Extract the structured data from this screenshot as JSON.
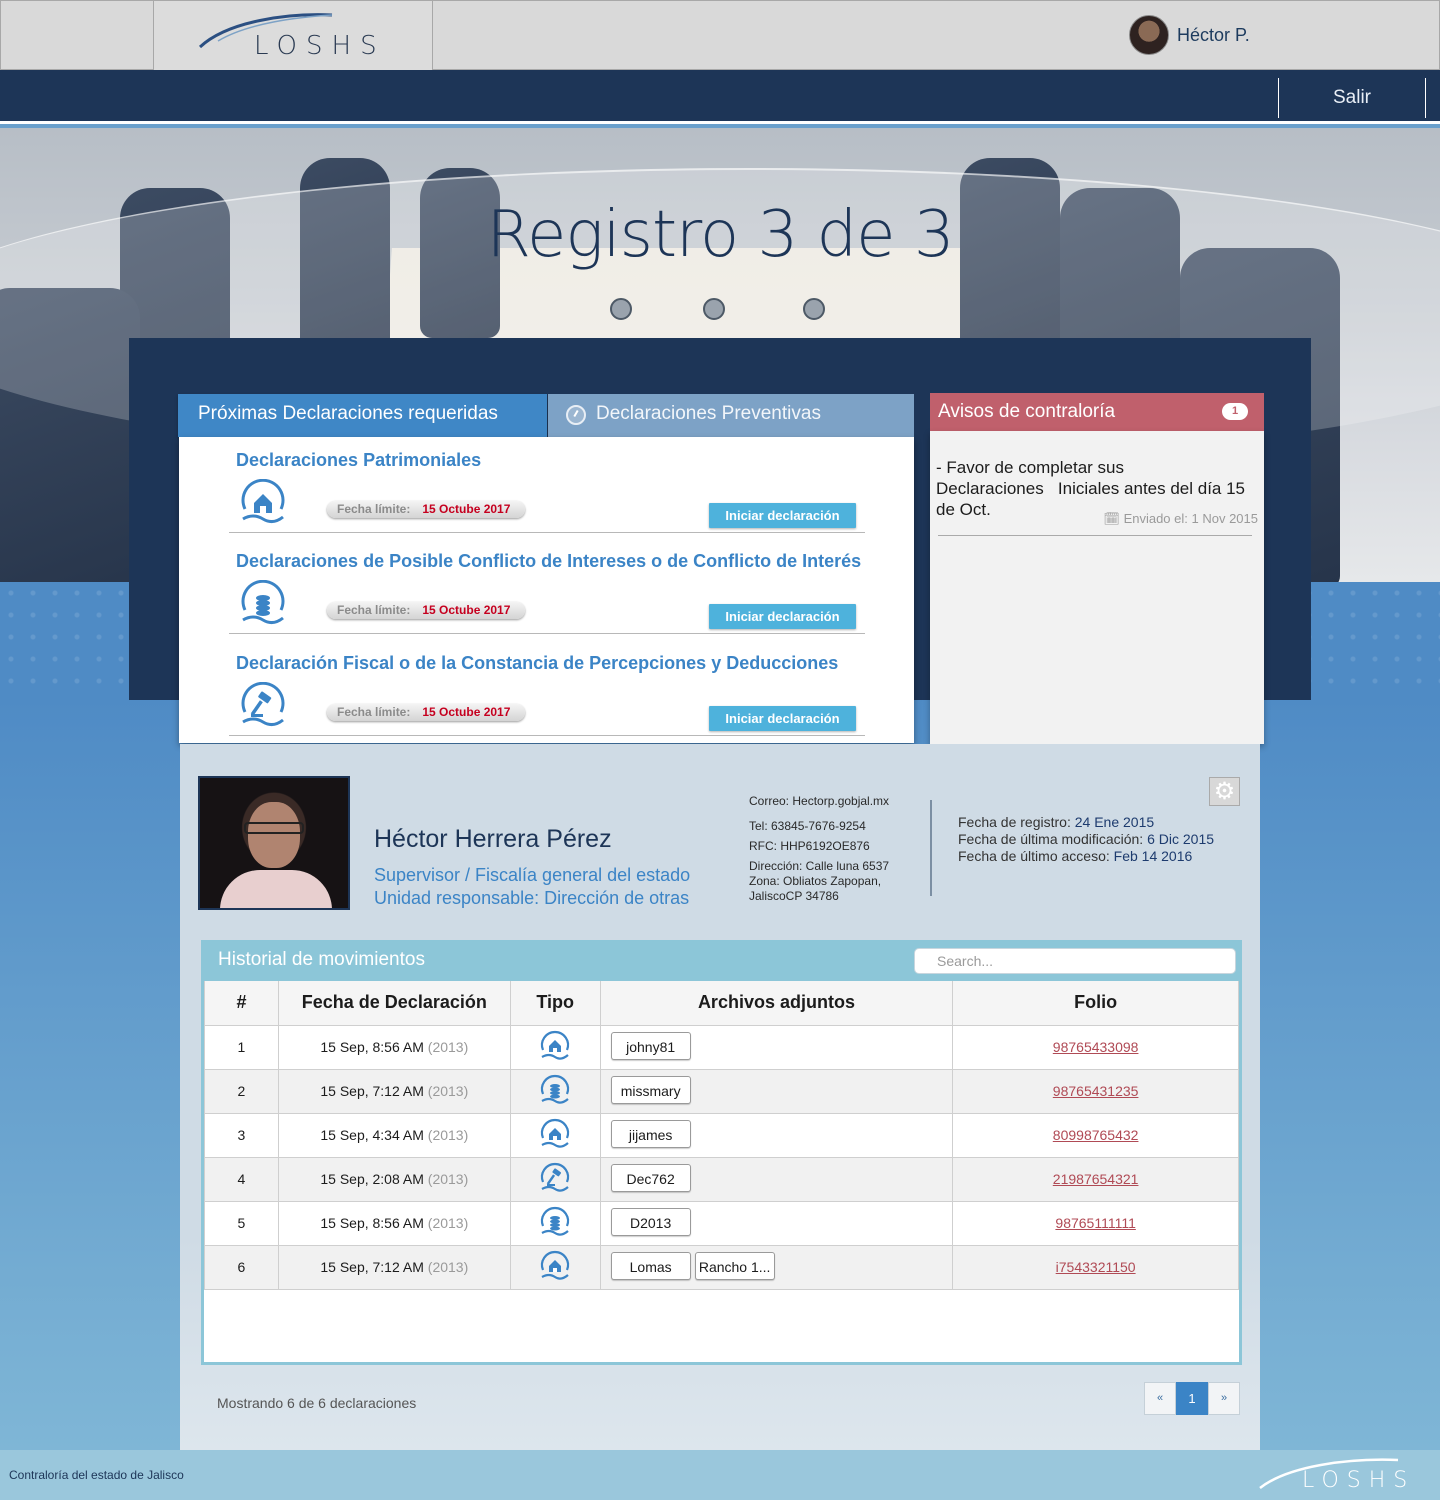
{
  "header": {
    "logo_text": "LOSHS",
    "user_name": "Héctor P.",
    "logout_label": "Salir"
  },
  "hero": {
    "title": "Registro 3 de 3",
    "steps": 3
  },
  "tabs": {
    "required_label": "Próximas Declaraciones requeridas",
    "preventive_label": "Declaraciones Preventivas"
  },
  "declarations": [
    {
      "title": "Declaraciones Patrimoniales",
      "icon": "house-hand-icon",
      "deadline_label": "Fecha límite:",
      "deadline": "15 Octube 2017",
      "button": "Iniciar declaración"
    },
    {
      "title": "Declaraciones de Posible Conflicto de Intereses o de Conflicto de Interés",
      "icon": "coins-hand-icon",
      "deadline_label": "Fecha límite:",
      "deadline": "15 Octube 2017",
      "button": "Iniciar declaración"
    },
    {
      "title": "Declaración Fiscal o de la Constancia de Percepciones y Deducciones",
      "icon": "gavel-hand-icon",
      "deadline_label": "Fecha límite:",
      "deadline": "15 Octube 2017",
      "button": "Iniciar declaración"
    }
  ],
  "avisos": {
    "title": "Avisos de contraloría",
    "count": "1",
    "message": "- Favor de completar sus Declaraciones   Iniciales antes del día 15 de Oct.",
    "sent": "Enviado el: 1 Nov 2015"
  },
  "profile": {
    "name": "Héctor Herrera Pérez",
    "role": "Supervisor / Fiscalía general del estado",
    "unit": "Unidad responsable: Dirección de otras",
    "email": "Correo: Hectorp.gobjal.mx",
    "phone": "Tel: 63845-7676-9254",
    "rfc": "RFC: HHP6192OE876",
    "address_1": "Dirección: Calle luna 6537",
    "address_2": "Zona: Obliatos  Zapopan,",
    "address_3": "JaliscoCP 34786",
    "registro_label": "Fecha de registro:",
    "registro": "24 Ene 2015",
    "modificacion_label": "Fecha de última modificación:",
    "modificacion": "6 Dic 2015",
    "acceso_label": "Fecha de último acceso:",
    "acceso": "Feb 14 2016"
  },
  "history": {
    "title": "Historial de movimientos",
    "search_placeholder": "Search...",
    "columns": [
      "#",
      "Fecha de Declaración",
      "Tipo",
      "Archivos adjuntos",
      "Folio"
    ],
    "rows": [
      {
        "n": "1",
        "date": "15 Sep, 8:56 AM",
        "year": "(2013)",
        "tipo": "house-hand-icon",
        "files": [
          "johny81"
        ],
        "folio": "98765433098"
      },
      {
        "n": "2",
        "date": "15 Sep, 7:12 AM",
        "year": "(2013)",
        "tipo": "coins-hand-icon",
        "files": [
          "missmary"
        ],
        "folio": "98765431235"
      },
      {
        "n": "3",
        "date": "15 Sep, 4:34 AM",
        "year": "(2013)",
        "tipo": "house-hand-icon",
        "files": [
          "jijames"
        ],
        "folio": "80998765432"
      },
      {
        "n": "4",
        "date": "15 Sep, 2:08 AM",
        "year": "(2013)",
        "tipo": "gavel-hand-icon",
        "files": [
          "Dec762"
        ],
        "folio": "21987654321"
      },
      {
        "n": "5",
        "date": "15 Sep, 8:56 AM",
        "year": "(2013)",
        "tipo": "coins-hand-icon",
        "files": [
          "D2013"
        ],
        "folio": "98765111111"
      },
      {
        "n": "6",
        "date": "15 Sep, 7:12 AM",
        "year": "(2013)",
        "tipo": "house-hand-icon",
        "files": [
          "Lomas",
          "Rancho 1..."
        ],
        "folio": "i7543321150"
      }
    ],
    "summary": "Mostrando 6 de 6 declaraciones",
    "pager": {
      "prev": "«",
      "current": "1",
      "next": "»"
    }
  },
  "footer": {
    "text": "Contraloría del estado de Jalisco",
    "logo_text": "LOSHS"
  },
  "colors": {
    "navy": "#1d3557",
    "accent_blue": "#3b84c6",
    "button_cyan": "#4eb2dc",
    "alert_red": "#c0606c",
    "deadline_red": "#c5001f",
    "folio_link": "#b04a55"
  }
}
